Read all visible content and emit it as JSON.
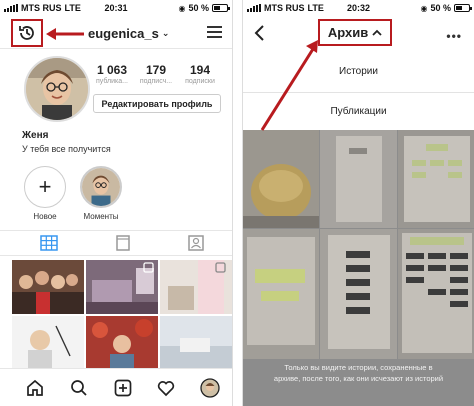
{
  "left_screen": {
    "status_bar": {
      "carrier": "MTS RUS",
      "network": "LTE",
      "time": "20:31",
      "battery": "50 %"
    },
    "header": {
      "username": "eugenica_s"
    },
    "profile": {
      "stats": [
        {
          "value": "1 063",
          "label": "публика..."
        },
        {
          "value": "179",
          "label": "подписч..."
        },
        {
          "value": "194",
          "label": "подписки"
        }
      ],
      "edit_button": "Редактировать профиль",
      "name": "Женя",
      "bio": "У тебя все получится"
    },
    "highlights": [
      {
        "label": "Новое"
      },
      {
        "label": "Моменты"
      }
    ]
  },
  "right_screen": {
    "status_bar": {
      "carrier": "MTS RUS",
      "network": "LTE",
      "time": "20:32",
      "battery": "50 %"
    },
    "header": {
      "title": "Архив"
    },
    "options": [
      "Истории",
      "Публикации"
    ],
    "footer_note_line1": "Только вы видите истории, сохраненные в",
    "footer_note_line2": "архиве, после того, как они исчезают из историй"
  },
  "colors": {
    "annotation_red": "#b81b1f",
    "instagram_blue": "#3897f0"
  }
}
